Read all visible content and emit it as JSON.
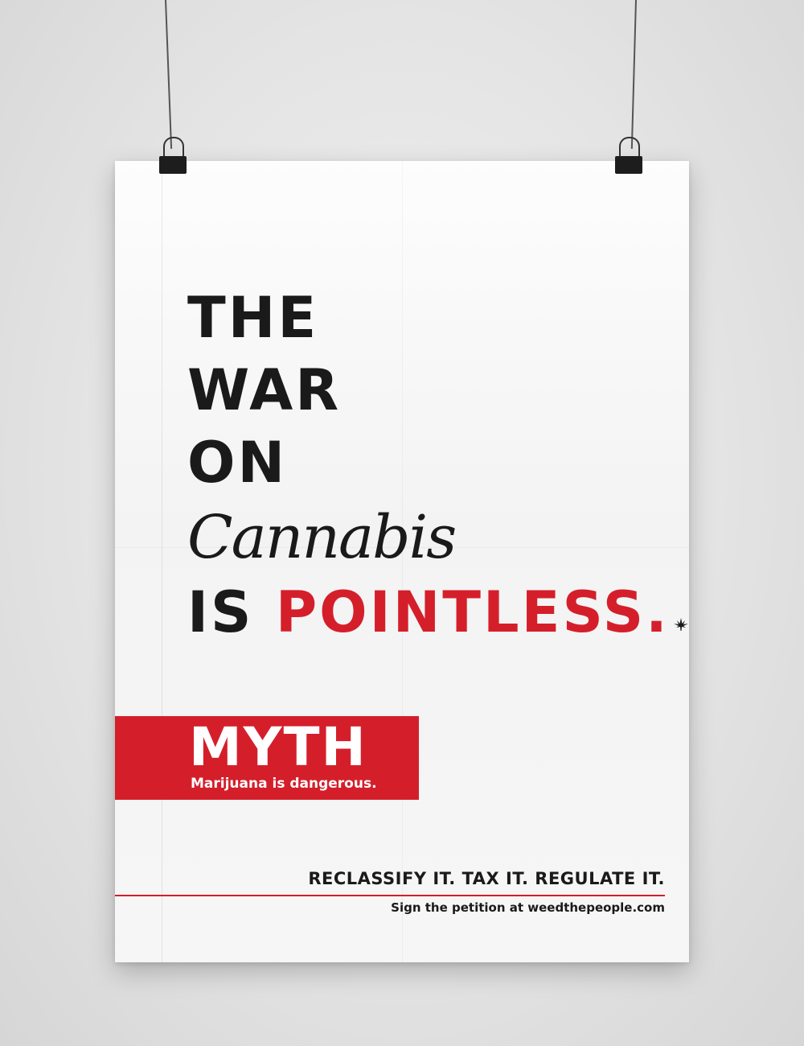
{
  "headline": {
    "line1": "THE",
    "line2": "WAR",
    "line3": "ON",
    "line4": "Cannabis",
    "line5_prefix": "IS",
    "line5_emphasis": "POINTLESS",
    "line5_period": "."
  },
  "myth": {
    "label": "MYTH",
    "statement": "Marijuana is dangerous."
  },
  "footer": {
    "slogan": "RECLASSIFY IT. TAX IT. REGULATE IT.",
    "call_to_action": "Sign the petition at weedthepeople.com"
  },
  "colors": {
    "accent": "#d41f2b",
    "text": "#1a1a1a",
    "background": "#e4e4e4"
  },
  "icons": [
    "cannabis-leaf-icon",
    "binder-clip-icon"
  ]
}
